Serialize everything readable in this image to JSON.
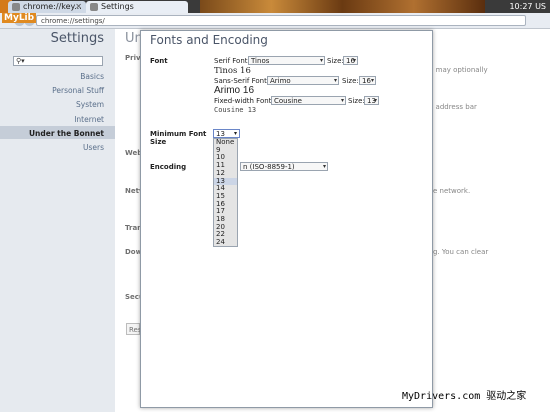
{
  "window": {
    "app_label": "MyLib",
    "tabs": [
      {
        "label": "chrome://key..."
      },
      {
        "label": "Settings"
      }
    ],
    "clock": "10:27 US",
    "address": "chrome://settings/"
  },
  "sidebar": {
    "title": "Settings",
    "search_placeholder": "",
    "items": [
      {
        "label": "Basics"
      },
      {
        "label": "Personal Stuff"
      },
      {
        "label": "System"
      },
      {
        "label": "Internet"
      },
      {
        "label": "Under the Bonnet"
      },
      {
        "label": "Users"
      }
    ]
  },
  "content": {
    "title_partial": "Un",
    "sections": [
      {
        "label": "Priv"
      },
      {
        "label": "Web"
      },
      {
        "label": "Netv"
      },
      {
        "label": "Tran"
      },
      {
        "label": "Dow"
      },
      {
        "label": "Secu"
      }
    ],
    "fragments": [
      {
        "text": "u may optionally"
      },
      {
        "text": "e address bar"
      },
      {
        "text": "e network."
      },
      {
        "text": "g. You can clear"
      }
    ],
    "reset_button_partial": "Res"
  },
  "dialog": {
    "title": "Fonts and Encoding",
    "font_label": "Font",
    "serif_label": "Serif Font:",
    "serif_font": "Tinos",
    "serif_size_label": "Size:",
    "serif_size": "16",
    "serif_preview": "Tinos 16",
    "sans_label": "Sans-Serif Font:",
    "sans_font": "Arimo",
    "sans_size_label": "Size:",
    "sans_size": "16",
    "sans_preview": "Arimo 16",
    "fixed_label": "Fixed-width Font:",
    "fixed_font": "Cousine",
    "fixed_size_label": "Size:",
    "fixed_size": "13",
    "fixed_preview": "Cousine 13",
    "min_font_label_1": "Minimum Font",
    "min_font_label_2": "Size",
    "min_font_value": "13",
    "min_font_options": [
      "None",
      "9",
      "10",
      "11",
      "12",
      "13",
      "14",
      "15",
      "16",
      "17",
      "18",
      "20",
      "22",
      "24"
    ],
    "encoding_label": "Encoding",
    "encoding_value": "n (ISO-8859-1)"
  },
  "watermark": "MyDrivers.com 驱动之家"
}
